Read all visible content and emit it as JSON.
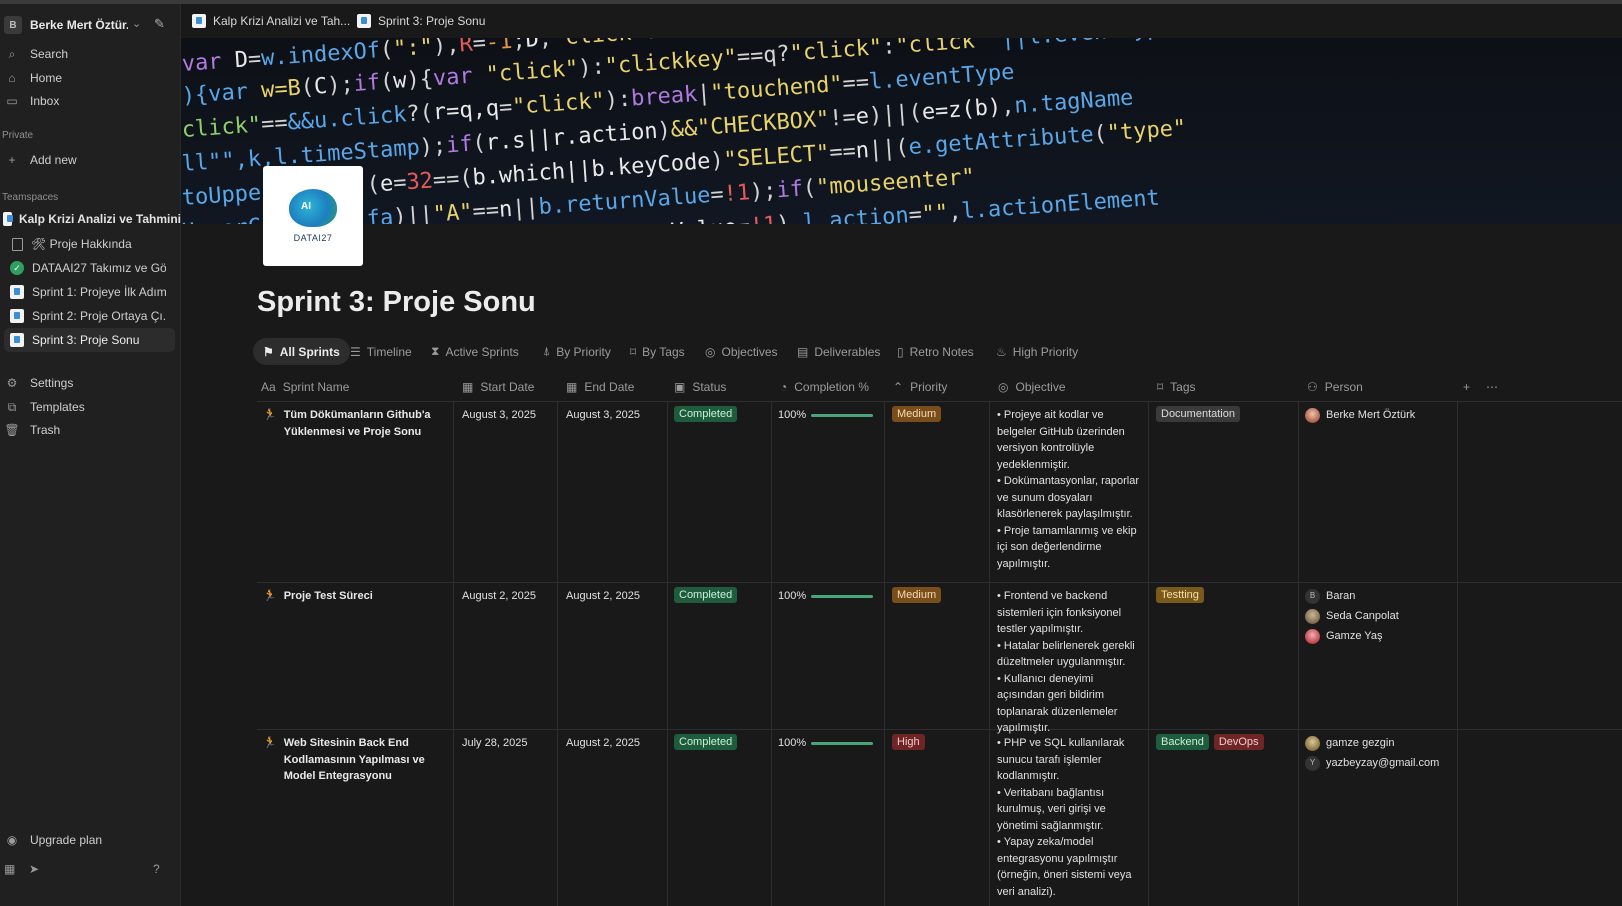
{
  "sidebar": {
    "workspace": {
      "avatar": "B",
      "name": "Berke Mert Öztür..."
    },
    "nav": [
      {
        "label": "Search",
        "icon": "search-icon"
      },
      {
        "label": "Home",
        "icon": "home-icon"
      },
      {
        "label": "Inbox",
        "icon": "inbox-icon"
      }
    ],
    "private_label": "Private",
    "add_new": "Add new",
    "teamspaces_label": "Teamspaces",
    "teamspace": "Kalp Krizi Analizi ve Tahmini",
    "pages": [
      {
        "label": "🛠 Proje Hakkında",
        "icon": "document-icon"
      },
      {
        "label": "DATAAI27 Takımız ve Gör...",
        "icon": "check-circle-icon"
      },
      {
        "label": "Sprint 1: Projeye İlk Adım",
        "icon": "page-icon"
      },
      {
        "label": "Sprint 2: Proje Ortaya Çı...",
        "icon": "page-icon"
      },
      {
        "label": "Sprint 3: Proje Sonu",
        "icon": "page-icon",
        "active": true
      }
    ],
    "settings": "Settings",
    "templates": "Templates",
    "trash": "Trash",
    "upgrade": "Upgrade plan"
  },
  "tabs": [
    {
      "label": "Kalp Krizi Analizi ve Tah..."
    },
    {
      "label": "Sprint 3: Proje Sonu"
    }
  ],
  "page": {
    "logo_text": "DATAI27",
    "logo_badge": "AI",
    "title": "Sprint 3: Proje Sonu"
  },
  "views": [
    {
      "label": "All Sprints",
      "active": true
    },
    {
      "label": "Timeline"
    },
    {
      "label": "Active Sprints"
    },
    {
      "label": "By Priority"
    },
    {
      "label": "By Tags"
    },
    {
      "label": "Objectives"
    },
    {
      "label": "Deliverables"
    },
    {
      "label": "Retro Notes"
    },
    {
      "label": "High Priority"
    }
  ],
  "table": {
    "columns": [
      "Sprint Name",
      "Start Date",
      "End Date",
      "Status",
      "Completion %",
      "Priority",
      "Objective",
      "Tags",
      "Person"
    ],
    "rows": [
      {
        "name": "Tüm Dökümanların Github'a Yüklenmesi ve Proje Sonu",
        "start": "August 3, 2025",
        "end": "August 3, 2025",
        "status": "Completed",
        "completion": "100%",
        "completion_fraction": 1.0,
        "priority": "Medium",
        "objective": "• Projeye ait kodlar ve belgeler GitHub üzerinden versiyon kontrolüyle yedeklenmiştir.\n• Dokümantasyonlar, raporlar ve sunum dosyaları klasörlenerek paylaşılmıştır.\n• Proje tamamlanmış ve ekip içi son değerlendirme yapılmıştır.",
        "tags": [
          "Documentation"
        ],
        "people": [
          {
            "name": "Berke Mert Öztürk",
            "avatar": ""
          }
        ]
      },
      {
        "name": "Proje Test Süreci",
        "start": "August 2, 2025",
        "end": "August 2, 2025",
        "status": "Completed",
        "completion": "100%",
        "completion_fraction": 1.0,
        "priority": "Medium",
        "objective": "• Frontend ve backend sistemleri için fonksiyonel testler yapılmıştır.\n• Hatalar belirlenerek gerekli düzeltmeler uygulanmıştır.\n• Kullanıcı deneyimi açısından geri bildirim toplanarak düzenlemeler yapılmıştır.",
        "tags": [
          "Testting"
        ],
        "people": [
          {
            "name": "Baran",
            "avatar": "B"
          },
          {
            "name": "Seda Canpolat",
            "avatar": ""
          },
          {
            "name": "Gamze Yaş",
            "avatar": ""
          }
        ]
      },
      {
        "name": "Web Sitesinin Back End Kodlamasının Yapılması ve Model Entegrasyonu",
        "start": "July 28, 2025",
        "end": "August 2, 2025",
        "status": "Completed",
        "completion": "100%",
        "completion_fraction": 1.0,
        "priority": "High",
        "objective": "•  PHP ve SQL kullanılarak sunucu tarafı işlemler kodlanmıştır.\n•  Veritabanı bağlantısı kurulmuş, veri girişi ve yönetimi sağlanmıştır.\n•  Yapay zeka/model entegrasyonu yapılmıştır (örneğin, öneri sistemi veya veri analizi).",
        "tags": [
          "Backend",
          "DevOps"
        ],
        "people": [
          {
            "name": "gamze gezgin",
            "avatar": ""
          },
          {
            "name": "yazbeyzay@gmail.com",
            "avatar": "Y"
          }
        ]
      }
    ]
  },
  "colors": {
    "background": "#191919",
    "sidebar": "#202020",
    "completed": "#1f5c3e",
    "medium": "#7a4e1a",
    "high": "#6e2525",
    "progress": "#4aa47a"
  }
}
